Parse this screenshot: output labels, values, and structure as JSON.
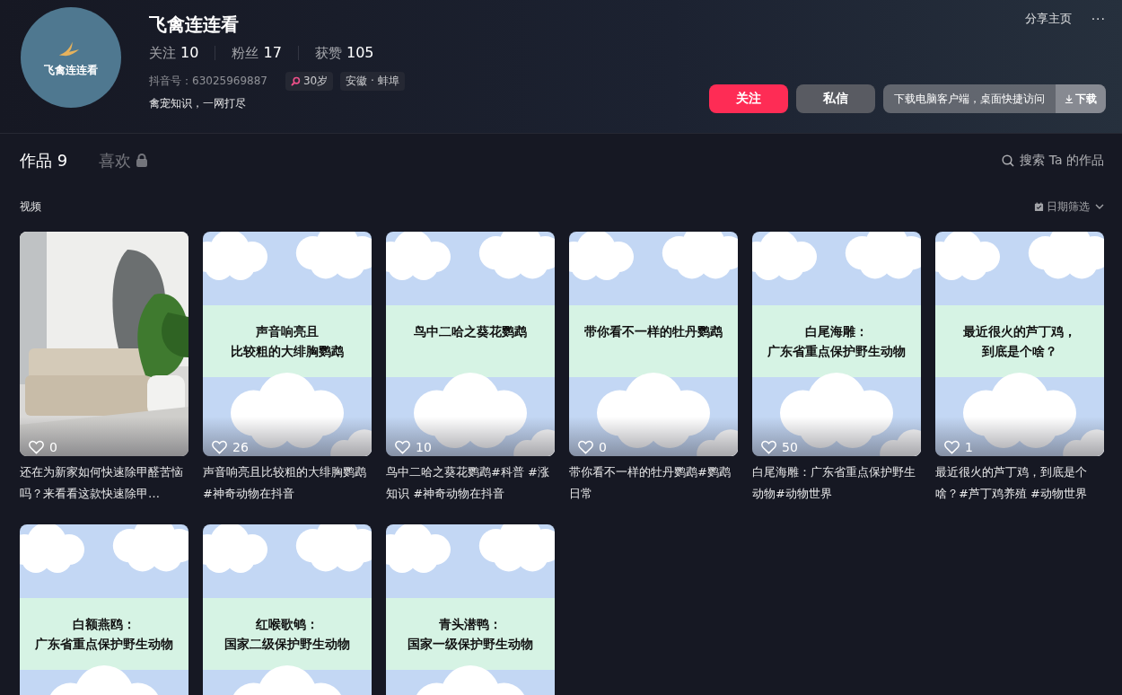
{
  "profile": {
    "avatar_text": "飞禽连连看",
    "name": "飞禽连连看",
    "stats": [
      {
        "label": "关注",
        "value": "10"
      },
      {
        "label": "粉丝",
        "value": "17"
      },
      {
        "label": "获赞",
        "value": "105"
      }
    ],
    "account_id": "抖音号：63025969887",
    "tags": [
      {
        "kind": "gender",
        "text": "30岁"
      },
      {
        "kind": "plain",
        "text": "安徽 · 蚌埠"
      }
    ],
    "bio": "禽宠知识，一网打尽"
  },
  "top_actions": {
    "share": "分享主页",
    "more": "···"
  },
  "buttons": [
    {
      "kind": "primary",
      "label": "关注"
    },
    {
      "kind": "secondary",
      "label": "私信"
    }
  ],
  "download_bar": {
    "text": "下载电脑客户端，桌面快捷访问",
    "button": "下载"
  },
  "tabs": [
    {
      "label": "作品",
      "count": "9",
      "selected": true,
      "locked": false
    },
    {
      "label": "喜欢",
      "selected": false,
      "locked": true
    }
  ],
  "search": {
    "label": "搜索 Ta 的作品"
  },
  "section_title": "视频",
  "date_filter": "日期筛选",
  "videos": [
    {
      "likes": "0",
      "caption": "还在为新家如何快速除甲醛苦恼吗？来看看这款快速除甲…"
    },
    {
      "kind": "cover",
      "cover_text": [
        "声音响亮且",
        "比较粗的大绯胸鹦鹉"
      ],
      "likes": "26",
      "caption": "声音响亮且比较粗的大绯胸鹦鹉#神奇动物在抖音"
    },
    {
      "kind": "cover",
      "cover_text": [
        "鸟中二哈之葵花鹦鹉"
      ],
      "likes": "10",
      "caption": "鸟中二哈之葵花鹦鹉#科普 #涨知识 #神奇动物在抖音"
    },
    {
      "kind": "cover",
      "cover_text": [
        "带你看不一样的牡丹鹦鹉"
      ],
      "likes": "0",
      "caption": "带你看不一样的牡丹鹦鹉#鹦鹉日常"
    },
    {
      "kind": "cover",
      "cover_text": [
        "白尾海雕：",
        "广东省重点保护野生动物"
      ],
      "likes": "50",
      "caption": "白尾海雕：广东省重点保护野生动物#动物世界"
    },
    {
      "kind": "cover",
      "cover_text": [
        "最近很火的芦丁鸡，",
        "到底是个啥？"
      ],
      "likes": "1",
      "caption": "最近很火的芦丁鸡，到底是个啥？#芦丁鸡养殖 #动物世界"
    },
    {
      "kind": "cover",
      "cover_text": [
        "白额燕鸥：",
        "广东省重点保护野生动物"
      ]
    },
    {
      "kind": "cover",
      "cover_text": [
        "红喉歌鸲：",
        "国家二级保护野生动物"
      ]
    },
    {
      "kind": "cover",
      "cover_text": [
        "青头潜鸭：",
        "国家一级保护野生动物"
      ]
    }
  ]
}
